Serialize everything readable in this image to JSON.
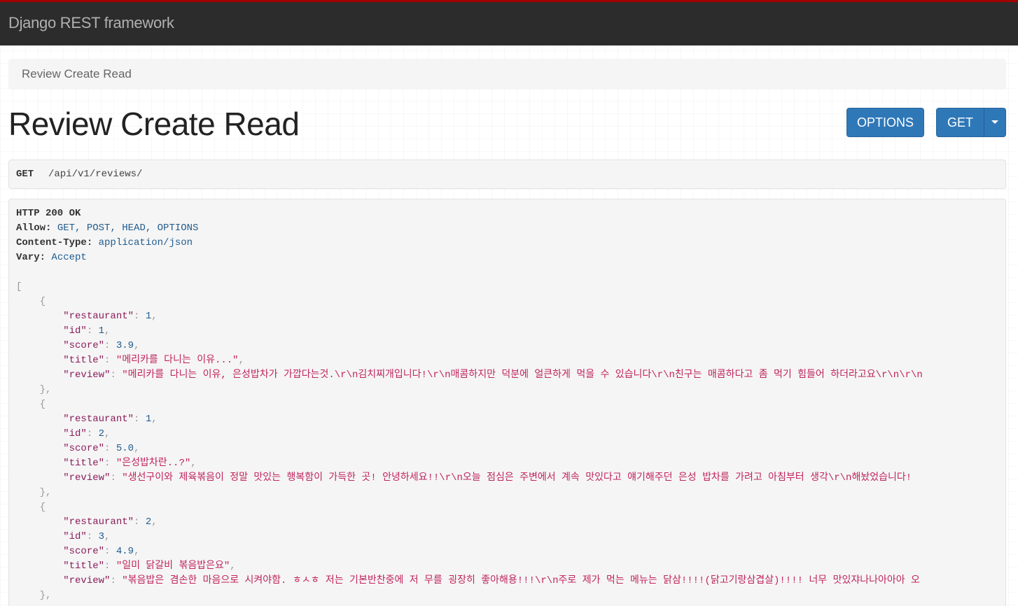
{
  "navbar": {
    "brand": "Django REST framework"
  },
  "breadcrumb": {
    "current": "Review Create Read"
  },
  "page": {
    "title": "Review Create Read"
  },
  "actions": {
    "options_label": "OPTIONS",
    "get_label": "GET"
  },
  "request": {
    "method": "GET",
    "path": "/api/v1/reviews/"
  },
  "response": {
    "status": "HTTP 200 OK",
    "headers": [
      {
        "name": "Allow:",
        "value": "GET, POST, HEAD, OPTIONS"
      },
      {
        "name": "Content-Type:",
        "value": "application/json"
      },
      {
        "name": "Vary:",
        "value": "Accept"
      }
    ],
    "items": [
      {
        "restaurant": "1",
        "id": "1",
        "score": "3.9",
        "title": "\"메리카를 다니는 이유...\"",
        "review": "\"메리카를 다니는 이유, 은성밥차가 가깝다는것.\\r\\n김치찌개입니다!\\r\\n매콤하지만 덕분에 얼큰하게 먹을 수 있습니다\\r\\n친구는 매콤하다고 좀 먹기 힘들어 하더라고요\\r\\n\\r\\n"
      },
      {
        "restaurant": "1",
        "id": "2",
        "score": "5.0",
        "title": "\"은성밥차란..?\"",
        "review": "\"생선구이와 제육볶음이 정말 맛있는 행복함이 가득한 곳! 안녕하세요!!\\r\\n오늘 점심은 주변에서 계속 맛있다고 얘기해주던 은성 밥차를 가려고 아침부터 생각\\r\\n해놨었습니다!"
      },
      {
        "restaurant": "2",
        "id": "3",
        "score": "4.9",
        "title": "\"일미 닭갈비 볶음밥은요\"",
        "review": "\"볶음밥은 겸손한 마음으로 시켜야함. ㅎㅅㅎ 저는 기본반찬중에 저 무를 굉장히 좋아해용!!!\\r\\n주로 제가 먹는 메뉴는 닭삼!!!!(닭고기랑삼겹살)!!!! 너무 맛있쟈나나아아아 오"
      }
    ]
  }
}
